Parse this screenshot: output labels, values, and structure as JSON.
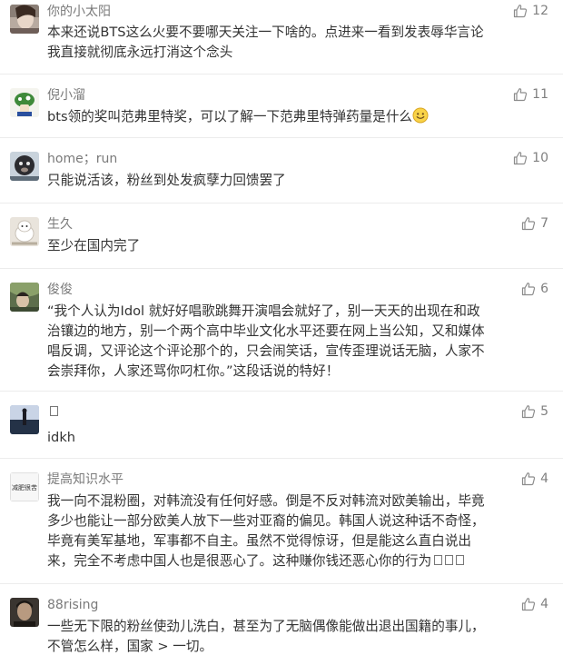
{
  "comments": [
    {
      "user": "你的小太阳",
      "likes": "12",
      "lines": [
        "本来还说BTS这么火要不要哪天关注一下啥的。点进来一看到发表辱华言论",
        "我直接就彻底永远打消这个念头"
      ]
    },
    {
      "user": "倪小溜",
      "likes": "11",
      "lines": [
        "bts领的奖叫范弗里特奖，可以了解一下范弗里特弹药量是什么"
      ],
      "emoji": "smile-emoji"
    },
    {
      "user": "home；run",
      "likes": "10",
      "lines": [
        "只能说活该，粉丝到处发疯孽力回馈罢了"
      ]
    },
    {
      "user": "生久",
      "likes": "7",
      "lines": [
        "至少在国内完了"
      ]
    },
    {
      "user": "俊俊",
      "likes": "6",
      "lines": [
        "“我个人认为Idol 就好好唱歌跳舞开演唱会就好了，别一天天的出现在和政",
        "治镶边的地方，别一个两个高中毕业文化水平还要在网上当公知，又和媒体",
        "唱反调，又评论这个评论那个的，只会闹笑话，宣传歪理说话无脑，人家不",
        "会崇拜你，人家还骂你叼杠你。”这段话说的特好！"
      ]
    },
    {
      "user": "",
      "likes": "5",
      "lines": [
        "idkh"
      ]
    },
    {
      "user": "提高知识水平",
      "likes": "4",
      "avatar_text": "减肥很苦",
      "lines": [
        "我一向不混粉圈，对韩流没有任何好感。倒是不反对韩流对欧美输出，毕竟",
        "多少也能让一部分欧美人放下一些对亚裔的偏见。韩国人说这种话不奇怪，",
        "毕竟有美军基地，军事都不自主。虽然不觉得惊讶，但是能这么直白说出",
        "来，完全不考虑中国人也是很恶心了。这种赚你钱还恶心你的行为"
      ]
    },
    {
      "user": "88rising",
      "likes": "4",
      "lines": [
        "一些无下限的粉丝使劲儿洗白，甚至为了无脑偶像能做出退出国籍的事儿，",
        "不管怎么样，国家 > 一切。"
      ]
    }
  ],
  "colors": {
    "username": "#7a7a7a",
    "text": "#333333",
    "icon": "#8c8c8c",
    "divider": "#ececec"
  },
  "icons": {
    "like": "thumbs-up-outline-icon"
  }
}
